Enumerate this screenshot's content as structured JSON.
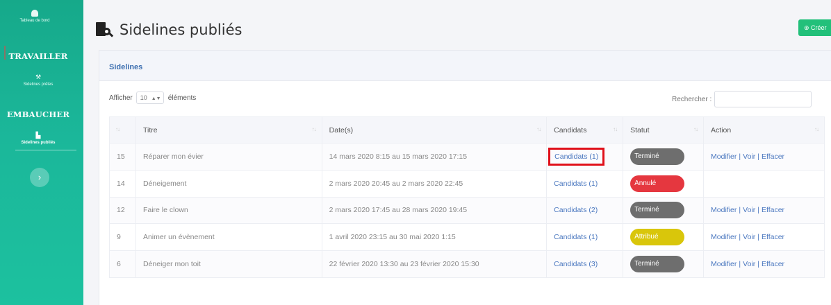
{
  "sidebar": {
    "dashboard_label": "Tableau de bord",
    "section_work": "TRAVAILLER",
    "work_item": "Sidelines prêtes",
    "section_hire": "EMBAUCHER",
    "hire_item": "Sidelines publiés",
    "toggle_glyph": "›"
  },
  "header": {
    "title": "Sidelines publiés",
    "create_label": "⊕ Créer"
  },
  "card": {
    "title": "Sidelines"
  },
  "controls": {
    "show_prefix": "Afficher",
    "page_size": "10",
    "show_suffix": "éléments",
    "search_label": "Rechercher :",
    "search_value": ""
  },
  "table": {
    "columns": [
      "",
      "Titre",
      "Date(s)",
      "Candidats",
      "Statut",
      "Action"
    ],
    "rows": [
      {
        "id": "15",
        "title": "Réparer mon évier",
        "dates": "14 mars 2020 8:15 au 15 mars 2020 17:15",
        "candidates": "Candidats (1)",
        "status": "Terminé",
        "status_color": "#6e6e6e",
        "actions": [
          "Modifier",
          "Voir",
          "Effacer"
        ]
      },
      {
        "id": "14",
        "title": "Déneigement",
        "dates": "2 mars 2020 20:45 au 2 mars 2020 22:45",
        "candidates": "Candidats (1)",
        "status": "Annulé",
        "status_color": "#e5373f",
        "actions": []
      },
      {
        "id": "12",
        "title": "Faire le clown",
        "dates": "2 mars 2020 17:45 au 28 mars 2020 19:45",
        "candidates": "Candidats (2)",
        "status": "Terminé",
        "status_color": "#6e6e6e",
        "actions": [
          "Modifier",
          "Voir",
          "Effacer"
        ]
      },
      {
        "id": "9",
        "title": "Animer un évènement",
        "dates": "1 avril 2020 23:15 au 30 mai 2020 1:15",
        "candidates": "Candidats (1)",
        "status": "Attribué",
        "status_color": "#d9c60b",
        "actions": [
          "Modifier",
          "Voir",
          "Effacer"
        ]
      },
      {
        "id": "6",
        "title": "Déneiger mon toit",
        "dates": "22 février 2020 13:30 au 23 février 2020 15:30",
        "candidates": "Candidats (3)",
        "status": "Terminé",
        "status_color": "#6e6e6e",
        "actions": [
          "Modifier",
          "Voir",
          "Effacer"
        ]
      }
    ]
  },
  "colors": {
    "sidebar": "#1bb79a",
    "link": "#4a77bf",
    "highlight": "#e0101a",
    "create_button": "#22c07a"
  }
}
